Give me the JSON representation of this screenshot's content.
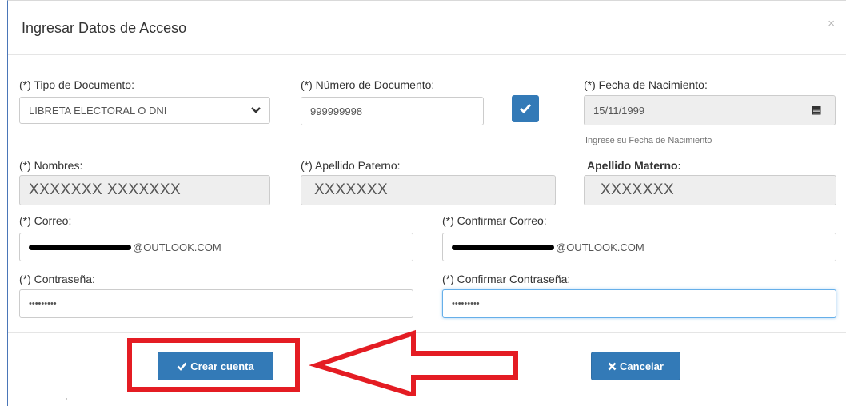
{
  "modal": {
    "title": "Ingresar Datos de Acceso",
    "close_label": "×"
  },
  "form": {
    "tipo_documento": {
      "label": "(*) Tipo de Documento:",
      "value": "LIBRETA ELECTORAL O DNI"
    },
    "numero_documento": {
      "label": "(*) Número de Documento:",
      "value": "999999998"
    },
    "fecha_nacimiento": {
      "label": "(*) Fecha de Nacimiento:",
      "value": "15/11/1999",
      "help": "Ingrese su Fecha de Nacimiento"
    },
    "nombres": {
      "label": "(*) Nombres:",
      "value": "XXXXXXX XXXXXXX"
    },
    "apellido_paterno": {
      "label": "(*) Apellido Paterno:",
      "value": "XXXXXXX"
    },
    "apellido_materno": {
      "label": "Apellido Materno:",
      "value": "XXXXXXX"
    },
    "correo": {
      "label": "(*) Correo:",
      "value_suffix": "@OUTLOOK.COM"
    },
    "confirmar_correo": {
      "label": "(*) Confirmar Correo:",
      "value_suffix": "@OUTLOOK.COM"
    },
    "contrasena": {
      "label": "(*) Contraseña:",
      "value": "•••••••••"
    },
    "confirmar_contrasena": {
      "label": "(*) Confirmar Contraseña:",
      "value": "•••••••••"
    }
  },
  "footer": {
    "crear_label": "Crear cuenta",
    "cancelar_label": "Cancelar",
    "stray_mark": "'"
  },
  "icons": {
    "check": "check-icon",
    "calendar": "calendar-icon",
    "chevron": "chevron-down-icon",
    "times": "times-icon",
    "annotation_arrow": "arrow-left-icon"
  },
  "colors": {
    "primary": "#337ab7",
    "annotation": "#e41c23",
    "readonly_bg": "#eeeeee"
  }
}
